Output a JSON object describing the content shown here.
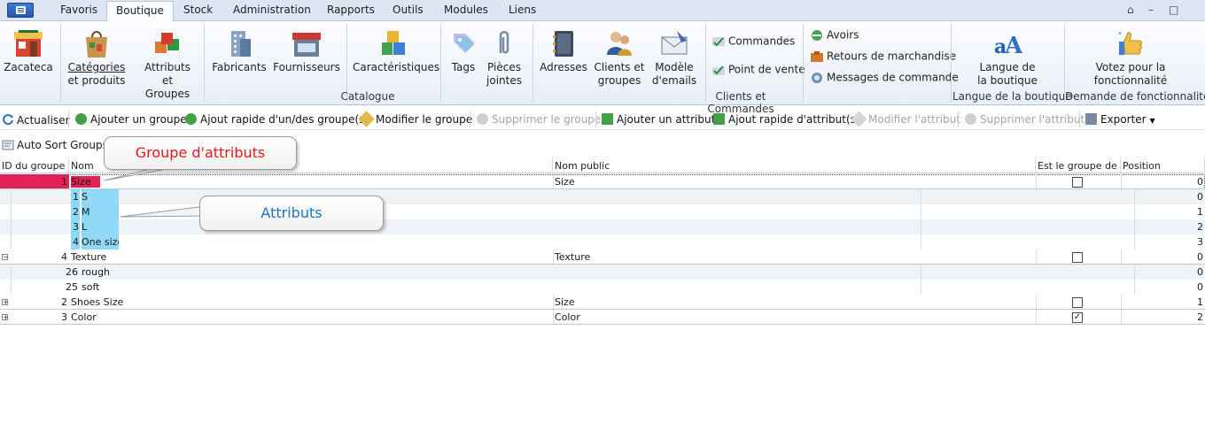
{
  "tabs": [
    "Favoris",
    "Boutique",
    "Stock",
    "Administration",
    "Rapports",
    "Outils",
    "Modules",
    "Liens"
  ],
  "window_controls": [
    "⌂",
    "–",
    "□"
  ],
  "ribbon": {
    "zacateca": "Zacateca",
    "categories": [
      "Catégories",
      "et produits"
    ],
    "attributs": [
      "Attributs",
      "et Groupes"
    ],
    "fabricants": "Fabricants",
    "fournisseurs": "Fournisseurs",
    "caracteristiques": "Caractéristiques",
    "tags": "Tags",
    "pieces": [
      "Pièces",
      "jointes"
    ],
    "catalogue_label": "Catalogue",
    "adresses": "Adresses",
    "clients": [
      "Clients et",
      "groupes"
    ],
    "modele": [
      "Modèle",
      "d'emails"
    ],
    "commandes": "Commandes",
    "point_de_vente": "Point de vente",
    "avoirs": "Avoirs",
    "retours": "Retours de marchandise",
    "messages": "Messages de commande",
    "clients_label": "Clients et Commandes",
    "langue": [
      "Langue de",
      "la boutique"
    ],
    "langue_label": "Langue de la boutique",
    "votez": [
      "Votez pour la",
      "fonctionnalité"
    ],
    "demande_label": "Demande de fonctionnalité"
  },
  "toolbar": {
    "actualiser": "Actualiser",
    "ajouter_groupe": "Ajouter un groupe",
    "ajout_rapide_groupe": "Ajout rapide d'un/des groupe(s)",
    "modifier_groupe": "Modifier le groupe",
    "supprimer_groupe": "Supprimer le groupe",
    "ajouter_attribut": "Ajouter un attribut",
    "ajout_rapide_attribut": "Ajout rapide d'attribut(s)",
    "modifier_attribut": "Modifier l'attribut",
    "supprimer_attribut": "Supprimer l'attribut",
    "exporter": "Exporter"
  },
  "auto_sort": "Auto Sort Groups",
  "grid": {
    "headers": {
      "id": "ID du groupe",
      "nom": "Nom",
      "nom_public": "Nom public",
      "est_groupe": "Est le groupe de co",
      "position": "Position"
    },
    "groups": [
      {
        "id": "1",
        "nom": "Size",
        "public": "Size",
        "checked": false,
        "position": "0",
        "expanded": true,
        "children": [
          {
            "id": "1",
            "nom": "S",
            "position": "0"
          },
          {
            "id": "2",
            "nom": "M",
            "position": "1"
          },
          {
            "id": "3",
            "nom": "L",
            "position": "2"
          },
          {
            "id": "4",
            "nom": "One size",
            "position": "3"
          }
        ]
      },
      {
        "id": "4",
        "nom": "Texture",
        "public": "Texture",
        "checked": false,
        "position": "0",
        "expanded": true,
        "children": [
          {
            "id": "26",
            "nom": "rough",
            "position": "0"
          },
          {
            "id": "25",
            "nom": "soft",
            "position": "0"
          }
        ]
      },
      {
        "id": "2",
        "nom": "Shoes Size",
        "public": "Size",
        "checked": false,
        "position": "1",
        "expanded": false,
        "children": []
      },
      {
        "id": "3",
        "nom": "Color",
        "public": "Color",
        "checked": true,
        "position": "2",
        "expanded": false,
        "children": []
      }
    ]
  },
  "callouts": {
    "groupe": "Groupe d'attributs",
    "attributs": "Attributs"
  },
  "colors": {
    "highlight_group": "#e0215a",
    "highlight_attr": "#8fd8f7",
    "callout_red": "#e0191b",
    "callout_blue": "#1b74c9"
  }
}
